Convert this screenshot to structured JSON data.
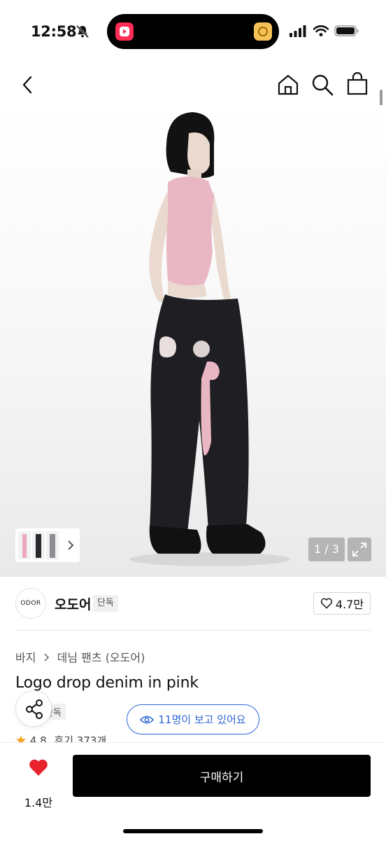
{
  "status_bar": {
    "time": "12:58",
    "icons": [
      "bell-slash-icon",
      "cellular-icon",
      "wifi-icon",
      "battery-icon"
    ]
  },
  "nav": {
    "icons": [
      "back-icon",
      "home-icon",
      "search-icon",
      "bag-icon"
    ]
  },
  "gallery": {
    "counter": "1 / 3",
    "current_index": 1,
    "total": 3
  },
  "brand": {
    "logo_text": "ODOR",
    "name": "오도어",
    "tag": "단독",
    "likes": "4.7만"
  },
  "product": {
    "breadcrumb": [
      "바지",
      "데님 팬츠 (오도어)"
    ],
    "title": "Logo drop denim in pink",
    "exclusive_tag": "단독",
    "rating": "4.8",
    "reviews": "후기 373개"
  },
  "viewers_badge": "11명이 보고 있어요",
  "bottom_bar": {
    "wish_count": "1.4만",
    "buy_label": "구매하기"
  },
  "colors": {
    "accent_blue": "#2f66d6",
    "heart_red": "#e8232e",
    "buy_button": "#000000",
    "star": "#f5a623"
  }
}
